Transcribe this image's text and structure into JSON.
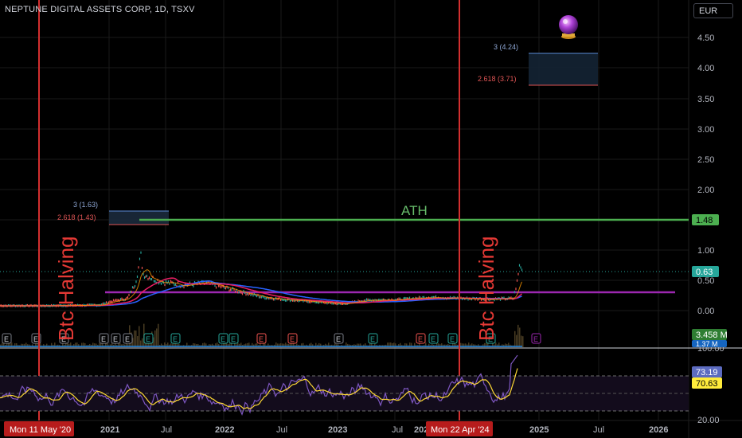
{
  "header": {
    "title": "NEPTUNE DIGITAL ASSETS CORP, 1D, TSXV",
    "currency": "EUR"
  },
  "chart_data": {
    "type": "line",
    "price_axis": {
      "ticks": [
        "4.50",
        "4.00",
        "3.50",
        "3.00",
        "2.50",
        "2.00",
        "1.50",
        "1.00",
        "0.50",
        "0.00"
      ],
      "ylim": [
        0,
        4.5
      ]
    },
    "time_axis": {
      "ticks": [
        "2021",
        "Jul",
        "2022",
        "Jul",
        "2023",
        "Jul",
        "2025",
        "Jul",
        "2026"
      ],
      "cursor_labels": [
        "Mon 11 May '20",
        "Mon 22 Apr '24"
      ],
      "partial_tick": "202"
    },
    "markers": {
      "halving_label": "Btc Halving",
      "crystal_ball_icon": "crystal-ball-icon"
    },
    "annotations": {
      "ath": "ATH",
      "fib_left": [
        "3 (1.63)",
        "2.618 (1.43)"
      ],
      "fib_right": [
        "3 (4.24)",
        "2.618 (3.71)"
      ]
    },
    "price_badges": {
      "ath_level": "1.48",
      "last_price": "0.63",
      "volume": "3.458 M",
      "volume_avg": "1.37 M"
    },
    "events": {
      "earnings": "E",
      "earnings_count": 16
    },
    "oscillator": {
      "ticks": [
        "100.00",
        "20.00"
      ],
      "value1": "73.19",
      "value2": "70.63"
    },
    "colors": {
      "halving": "#d32f2f",
      "ath": "#4caf50",
      "ath_text": "#66bb6a",
      "price_badge": "#26a69a",
      "volume_badge": "#2e7d32",
      "osc_badge1": "#5c6bc0",
      "osc_badge2": "#ffeb3b",
      "purple_line": "#9c27b0",
      "fib_blue": "#5b8bd8",
      "fib_red": "#e05555"
    }
  }
}
